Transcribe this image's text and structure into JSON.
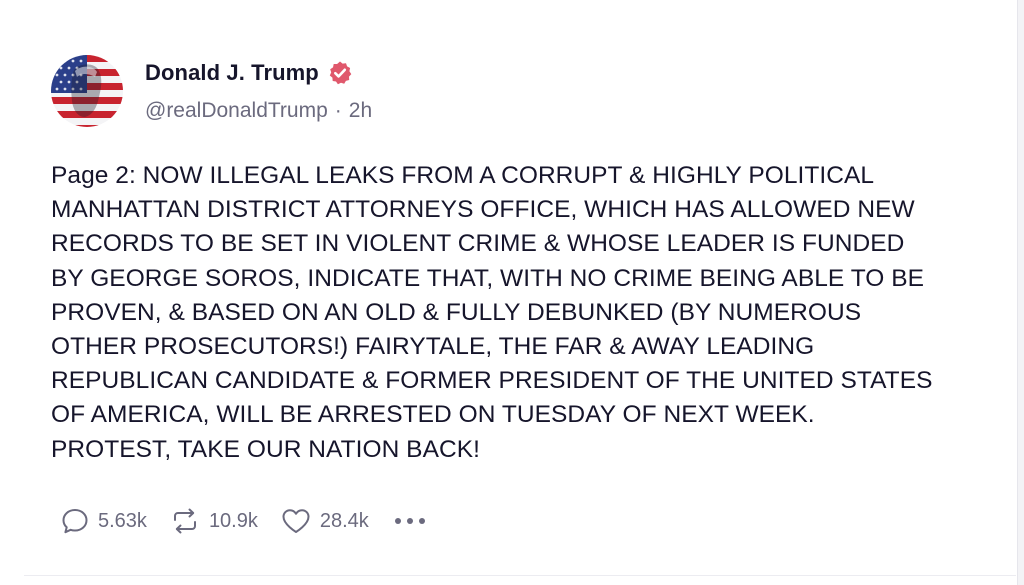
{
  "post": {
    "author": {
      "display_name": "Donald J. Trump",
      "handle": "@realDonaldTrump",
      "separator": "·",
      "time_ago": "2h",
      "avatar_icon": "flag-portrait-avatar",
      "verified_icon": "verified-badge-icon"
    },
    "text": "Page 2: NOW ILLEGAL LEAKS FROM A CORRUPT & HIGHLY POLITICAL\nMANHATTAN DISTRICT ATTORNEYS OFFICE, WHICH HAS ALLOWED NEW\nRECORDS TO BE SET IN VIOLENT CRIME & WHOSE LEADER IS FUNDED\nBY GEORGE SOROS, INDICATE THAT, WITH NO CRIME BEING ABLE TO BE\nPROVEN, & BASED ON AN OLD & FULLY DEBUNKED (BY NUMEROUS\nOTHER PROSECUTORS!) FAIRYTALE, THE FAR & AWAY LEADING\nREPUBLICAN CANDIDATE & FORMER PRESIDENT OF THE UNITED STATES\nOF AMERICA, WILL BE ARRESTED ON TUESDAY OF NEXT WEEK.\nPROTEST, TAKE OUR NATION BACK!",
    "actions": {
      "replies": {
        "icon": "reply-bubble-icon",
        "count": "5.63k"
      },
      "retruths": {
        "icon": "retruth-icon",
        "count": "10.9k"
      },
      "likes": {
        "icon": "heart-icon",
        "count": "28.4k"
      },
      "more": {
        "icon": "more-dots-icon"
      }
    }
  },
  "colors": {
    "text_primary": "#16152b",
    "text_secondary": "#6b6a7e",
    "verified_badge": "#e0586c",
    "background": "#ffffff"
  }
}
